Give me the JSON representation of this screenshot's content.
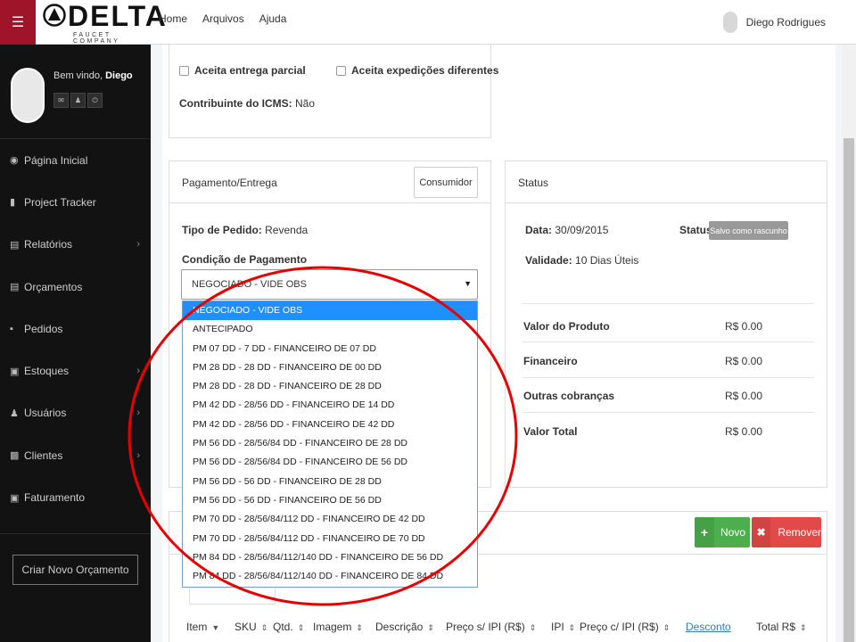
{
  "topbar": {
    "brand": "DELTA",
    "brand_sub": "FAUCET COMPANY",
    "nav": [
      "Home",
      "Arquivos",
      "Ajuda"
    ],
    "user_name": "Diego Rodrigues"
  },
  "sidebar": {
    "welcome_prefix": "Bem vindo, ",
    "welcome_name": "Diego",
    "items": [
      {
        "label": "Página Inicial",
        "icon": "dashboard-icon",
        "has_children": false
      },
      {
        "label": "Project Tracker",
        "icon": "binoculars-icon",
        "has_children": false
      },
      {
        "label": "Relatórios",
        "icon": "bar-chart-icon",
        "has_children": true
      },
      {
        "label": "Orçamentos",
        "icon": "document-icon",
        "has_children": false
      },
      {
        "label": "Pedidos",
        "icon": "truck-icon",
        "has_children": false
      },
      {
        "label": "Estoques",
        "icon": "box-icon",
        "has_children": true
      },
      {
        "label": "Usuários",
        "icon": "users-icon",
        "has_children": true
      },
      {
        "label": "Clientes",
        "icon": "briefcase-icon",
        "has_children": true
      },
      {
        "label": "Faturamento",
        "icon": "money-icon",
        "has_children": false
      }
    ],
    "create_button": "Criar Novo Orçamento"
  },
  "top_panel": {
    "aceita_entrega_parcial": "Aceita entrega parcial",
    "aceita_expedicoes": "Aceita expedições diferentes",
    "contribuinte_label": "Contribuinte do ICMS:",
    "contribuinte_value": "Não"
  },
  "pagamento": {
    "title": "Pagamento/Entrega",
    "consumidor_button": "Consumidor",
    "tipo_label": "Tipo de Pedido:",
    "tipo_value": "Revenda",
    "condicao_label": "Condição de Pagamento",
    "selected": "NEGOCIADO - VIDE OBS",
    "options": [
      "NEGOCIADO - VIDE OBS",
      "ANTECIPADO",
      "PM 07 DD - 7 DD - FINANCEIRO DE 07 DD",
      "PM 28 DD - 28 DD - FINANCEIRO DE 00 DD",
      "PM 28 DD - 28 DD - FINANCEIRO DE 28 DD",
      "PM 42 DD - 28/56 DD - FINANCEIRO DE 14 DD",
      "PM 42 DD - 28/56 DD - FINANCEIRO DE 42 DD",
      "PM 56 DD - 28/56/84 DD - FINANCEIRO DE 28 DD",
      "PM 56 DD - 28/56/84 DD - FINANCEIRO DE 56 DD",
      "PM 56 DD - 56 DD - FINANCEIRO DE 28 DD",
      "PM 56 DD - 56 DD - FINANCEIRO DE 56 DD",
      "PM 70 DD - 28/56/84/112 DD - FINANCEIRO DE 42 DD",
      "PM 70 DD - 28/56/84/112 DD - FINANCEIRO DE 70 DD",
      "PM 84 DD - 28/56/84/112/140 DD - FINANCEIRO DE 56 DD",
      "PM 84 DD - 28/56/84/112/140 DD - FINANCEIRO DE 84 DD"
    ]
  },
  "status_panel": {
    "title": "Status",
    "data_label": "Data:",
    "data_value": "30/09/2015",
    "status_label": "Status:",
    "status_badge": "Salvo como rascunho",
    "validade_label": "Validade:",
    "validade_value": "10 Dias Úteis",
    "rows": [
      {
        "label": "Valor do Produto",
        "value": "R$ 0.00"
      },
      {
        "label": "Financeiro",
        "value": "R$ 0.00"
      },
      {
        "label": "Outras cobranças",
        "value": "R$ 0.00"
      },
      {
        "label": "Valor Total",
        "value": "R$ 0.00"
      }
    ]
  },
  "items_panel": {
    "novo_button": "Novo",
    "remover_button": "Remover",
    "columns": [
      "Item",
      "SKU",
      "Qtd.",
      "Imagem",
      "Descrição",
      "Preço s/ IPI (R$)",
      "IPI",
      "Preço c/ IPI (R$)",
      "Desconto",
      "Total R$"
    ]
  },
  "colors": {
    "brand_red": "#a0142a",
    "sidebar_bg": "#121212",
    "selected_option": "#1e90ff",
    "success": "#4cae4c",
    "danger": "#e24a4a",
    "annotation": "#e60000"
  }
}
